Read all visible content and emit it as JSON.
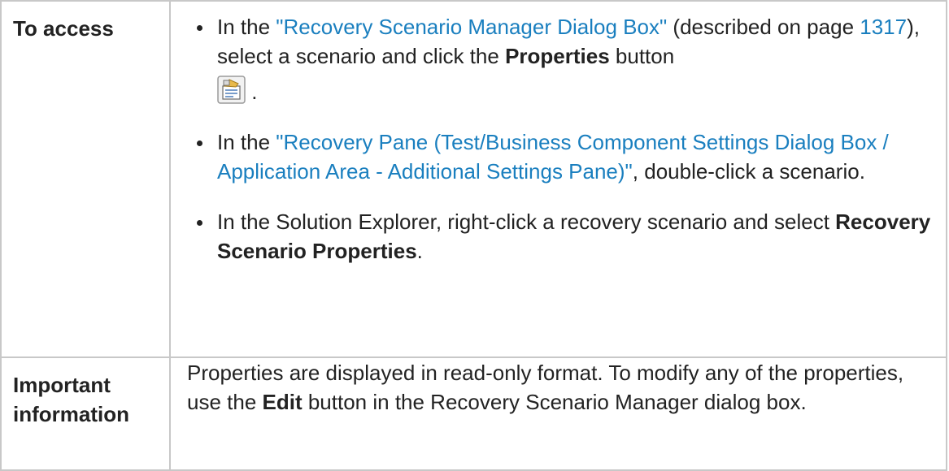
{
  "rows": {
    "access": {
      "label": "To access",
      "bullets": [
        {
          "pre": "In the ",
          "link": "\"Recovery Scenario Manager Dialog Box\"",
          "mid1": " (described on page ",
          "page_link": "1317",
          "mid2": "), select a scenario and click the ",
          "bold": "Properties",
          "post": " button",
          "icon": "properties-icon",
          "end": " ."
        },
        {
          "pre": "In the ",
          "link": "\"Recovery Pane (Test/Business Component Settings Dialog Box / Application Area - Additional Settings Pane)\"",
          "post": ", double-click a scenario."
        },
        {
          "pre": "In the Solution Explorer, right-click a recovery scenario and select ",
          "bold": "Recovery Scenario Properties",
          "post": "."
        }
      ]
    },
    "info": {
      "label": "Important information",
      "pre": "Properties are displayed in read-only format. To modify any of the properties, use the ",
      "bold": "Edit",
      "post": " button in the Recovery Scenario Manager dialog box."
    }
  },
  "colors": {
    "link": "#1a7fbf",
    "border": "#c8c8c8",
    "text": "#222222"
  }
}
